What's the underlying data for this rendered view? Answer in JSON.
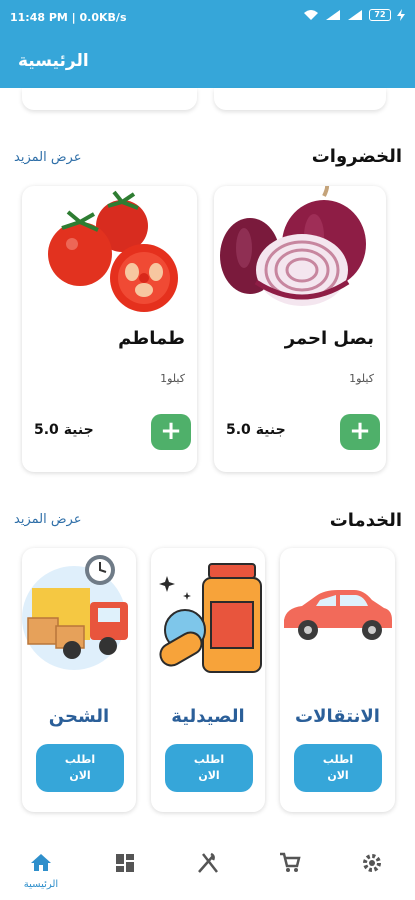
{
  "status_bar": {
    "time_info": "11:48 PM | 0.0KB/s",
    "battery": "72"
  },
  "app_bar": {
    "title": "الرئيسية"
  },
  "vegetables": {
    "title": "الخضروات",
    "see_more": "عرض المزيد",
    "products": [
      {
        "name": "بصل احمر",
        "unit": "1كيلو",
        "price": "5.0 جنية",
        "add_label": "+"
      },
      {
        "name": "طماطم",
        "unit": "1كيلو",
        "price": "5.0 جنية",
        "add_label": "+"
      }
    ]
  },
  "services": {
    "title": "الخدمات",
    "see_more": "عرض المزيد",
    "items": [
      {
        "name": "الانتقالات",
        "order_line1": "اطلب",
        "order_line2": "الان"
      },
      {
        "name": "الصيدلية",
        "order_line1": "اطلب",
        "order_line2": "الان"
      },
      {
        "name": "الشحن",
        "order_line1": "اطلب",
        "order_line2": "الان"
      }
    ]
  },
  "bottom_nav": {
    "items": [
      {
        "icon": "gear-icon"
      },
      {
        "icon": "cart-icon"
      },
      {
        "icon": "fork-knife-icon"
      },
      {
        "icon": "dashboard-icon"
      },
      {
        "icon": "home-icon",
        "label": "الرئيسية"
      }
    ],
    "active_color": "#2f8fcb"
  },
  "colors": {
    "primary": "#36a6d9",
    "add_button": "#4fb06a",
    "link": "#2f6fa8"
  }
}
